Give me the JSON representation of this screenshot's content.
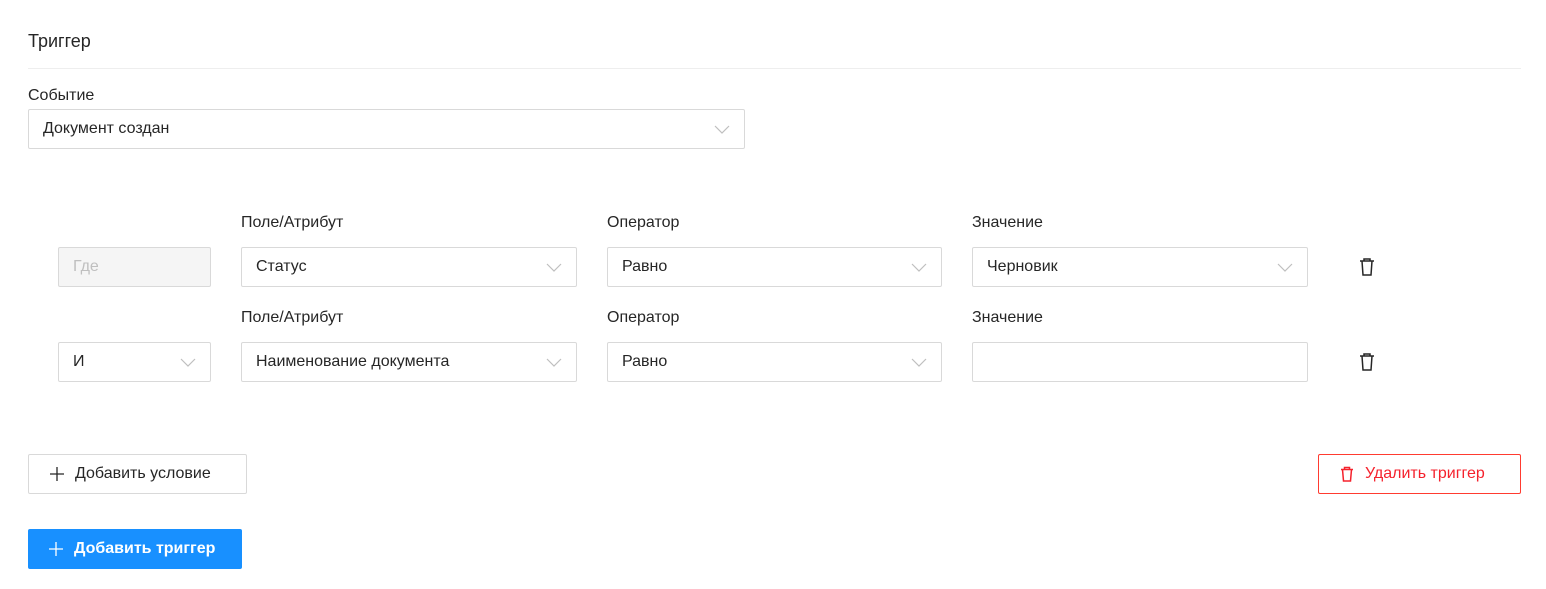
{
  "trigger": {
    "title": "Триггер",
    "event_label": "Событие",
    "event_value": "Документ создан"
  },
  "conditions": [
    {
      "connector": "Где",
      "field_label": "Поле/Атрибут",
      "field_value": "Статус",
      "operator_label": "Оператор",
      "operator_value": "Равно",
      "value_label": "Значение",
      "value_value": "Черновик"
    },
    {
      "connector": "И",
      "field_label": "Поле/Атрибут",
      "field_value": "Наименование документа",
      "operator_label": "Оператор",
      "operator_value": "Равно",
      "value_label": "Значение",
      "value_value": ""
    }
  ],
  "actions": {
    "add_condition": "Добавить условие",
    "delete_trigger": "Удалить триггер",
    "add_trigger": "Добавить триггер"
  },
  "colors": {
    "primary": "#1890ff",
    "danger": "#f5222d",
    "border": "#d9d9d9"
  },
  "icons": {
    "dropdown": "chevron-down-icon",
    "delete": "trash-icon",
    "add": "plus-icon"
  }
}
